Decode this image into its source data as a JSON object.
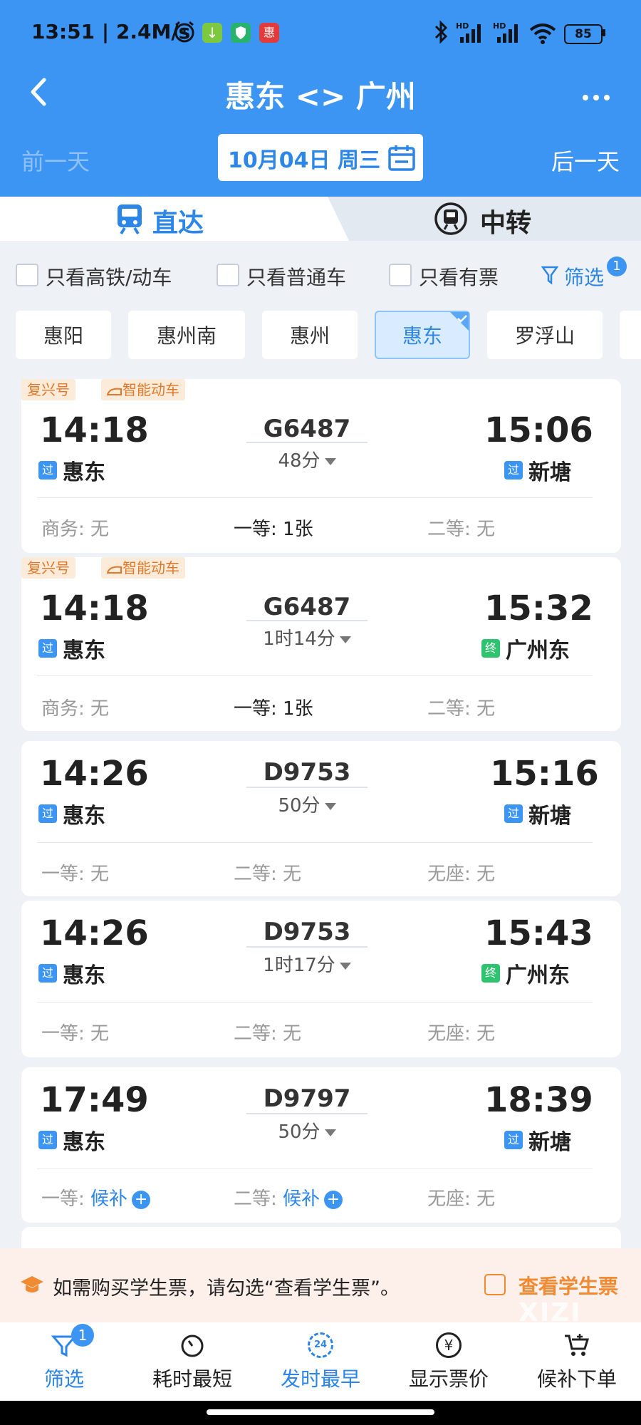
{
  "status_bar": {
    "time_speed": "13:51 | 2.4M/s",
    "net1": "HD",
    "net2": "HD",
    "battery": "85",
    "app_icon3_text": "惠"
  },
  "header": {
    "title": "惠东 <> 广州",
    "prev_day": "前一天",
    "next_day": "后一天",
    "date": "10月04日 周三"
  },
  "tabs": {
    "direct": "直达",
    "transfer": "中转"
  },
  "filters": {
    "high_speed_only": "只看高铁/动车",
    "regular_only": "只看普通车",
    "available_only": "只看有票",
    "filter_label": "筛选",
    "filter_count": "1"
  },
  "stations": [
    "惠阳",
    "惠州南",
    "惠州",
    "惠东",
    "罗浮山"
  ],
  "selected_station": "惠东",
  "trains": [
    {
      "tags": [
        "复兴号",
        "智能动车"
      ],
      "dep_time": "14:18",
      "dep_station": "惠东",
      "dep_badge": "过",
      "train_no": "G6487",
      "duration": "48分",
      "arr_time": "15:06",
      "arr_station": "新塘",
      "arr_badge": "过",
      "seats": [
        {
          "label": "商务:",
          "value": "无"
        },
        {
          "label": "一等:",
          "value": "1张"
        },
        {
          "label": "二等:",
          "value": "无"
        }
      ]
    },
    {
      "tags": [
        "复兴号",
        "智能动车"
      ],
      "dep_time": "14:18",
      "dep_station": "惠东",
      "dep_badge": "过",
      "train_no": "G6487",
      "duration": "1时14分",
      "arr_time": "15:32",
      "arr_station": "广州东",
      "arr_badge": "终",
      "seats": [
        {
          "label": "商务:",
          "value": "无"
        },
        {
          "label": "一等:",
          "value": "1张"
        },
        {
          "label": "二等:",
          "value": "无"
        }
      ]
    },
    {
      "tags": [],
      "dep_time": "14:26",
      "dep_station": "惠东",
      "dep_badge": "过",
      "train_no": "D9753",
      "duration": "50分",
      "arr_time": "15:16",
      "arr_station": "新塘",
      "arr_badge": "过",
      "seats": [
        {
          "label": "一等:",
          "value": "无"
        },
        {
          "label": "二等:",
          "value": "无"
        },
        {
          "label": "无座:",
          "value": "无"
        }
      ]
    },
    {
      "tags": [],
      "dep_time": "14:26",
      "dep_station": "惠东",
      "dep_badge": "过",
      "train_no": "D9753",
      "duration": "1时17分",
      "arr_time": "15:43",
      "arr_station": "广州东",
      "arr_badge": "终",
      "seats": [
        {
          "label": "一等:",
          "value": "无"
        },
        {
          "label": "二等:",
          "value": "无"
        },
        {
          "label": "无座:",
          "value": "无"
        }
      ]
    },
    {
      "tags": [],
      "dep_time": "17:49",
      "dep_station": "惠东",
      "dep_badge": "过",
      "train_no": "D9797",
      "duration": "50分",
      "arr_time": "18:39",
      "arr_station": "新塘",
      "arr_badge": "过",
      "seats": [
        {
          "label": "一等:",
          "value": "候补"
        },
        {
          "label": "二等:",
          "value": "候补"
        },
        {
          "label": "无座:",
          "value": "无"
        }
      ]
    }
  ],
  "student_notice": {
    "text": "如需购买学生票，请勾选“查看学生票”。",
    "checkbox_label": "查看学生票"
  },
  "watermark": "XIZI",
  "bottom_nav": {
    "filter": "筛选",
    "filter_count": "1",
    "shortest": "耗时最短",
    "earliest": "发时最早",
    "earliest_icon_text": "24",
    "show_price": "显示票价",
    "waitlist_order": "候补下单"
  },
  "colors": {
    "primary": "#3d95f3",
    "accent_text": "#2b86e8",
    "tag_bg": "#fdebd9",
    "tag_text": "#e0782b",
    "end_badge": "#2ec46f",
    "student_bar_bg": "#fdf0ea",
    "student_accent": "#f08a33"
  }
}
